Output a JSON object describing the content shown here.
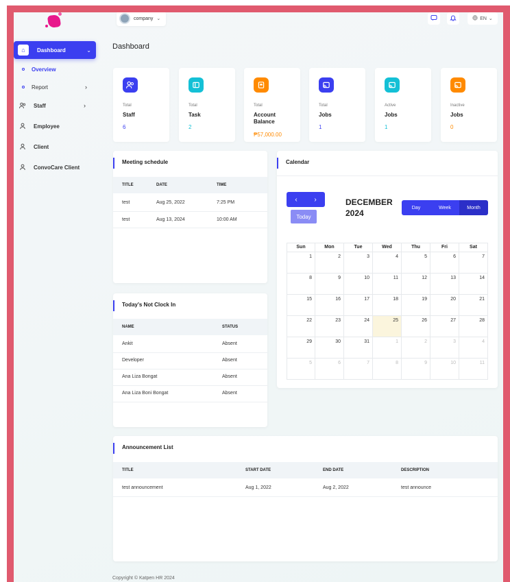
{
  "sidebar": {
    "items": [
      {
        "label": "Dashboard"
      },
      {
        "label": "Overview"
      },
      {
        "label": "Report"
      },
      {
        "label": "Staff"
      },
      {
        "label": "Employee"
      },
      {
        "label": "Client"
      },
      {
        "label": "ConvoCare Client"
      }
    ]
  },
  "header": {
    "company": "company",
    "language": "EN"
  },
  "page_title": "Dashboard",
  "stats": [
    {
      "caption": "Total",
      "title": "Staff",
      "value": "6",
      "icon": "users-icon",
      "icon_color": "#3b3ff0",
      "value_color": "#3b3ff0"
    },
    {
      "caption": "Total",
      "title": "Task",
      "value": "2",
      "icon": "task-icon",
      "icon_color": "#14c0d6",
      "value_color": "#14c0d6"
    },
    {
      "caption": "Total",
      "title": "Account Balance",
      "value": "₱57,000.00",
      "icon": "wallet-icon",
      "icon_color": "#ff8a00",
      "value_color": "#ff8a00"
    },
    {
      "caption": "Total",
      "title": "Jobs",
      "value": "1",
      "icon": "jobs-icon",
      "icon_color": "#3b3ff0",
      "value_color": "#3b3ff0"
    },
    {
      "caption": "Active",
      "title": "Jobs",
      "value": "1",
      "icon": "jobs-icon",
      "icon_color": "#14c0d6",
      "value_color": "#14c0d6"
    },
    {
      "caption": "Inactive",
      "title": "Jobs",
      "value": "0",
      "icon": "jobs-icon",
      "icon_color": "#ff8a00",
      "value_color": "#ff8a00"
    }
  ],
  "meeting": {
    "title": "Meeting schedule",
    "headers": [
      "TITLE",
      "DATE",
      "TIME"
    ],
    "rows": [
      [
        "test",
        "Aug 25, 2022",
        "7:25 PM"
      ],
      [
        "test",
        "Aug 13, 2024",
        "10:00 AM"
      ]
    ]
  },
  "not_clock_in": {
    "title": "Today's Not Clock In",
    "headers": [
      "NAME",
      "STATUS"
    ],
    "rows": [
      [
        "Ankit",
        "Absent"
      ],
      [
        "Developer",
        "Absent"
      ],
      [
        "Ana Liza Bongat",
        "Absent"
      ],
      [
        "Ana Liza Boni Bongat",
        "Absent"
      ]
    ]
  },
  "calendar": {
    "title": "Calendar",
    "prev": "‹",
    "next": "›",
    "today": "Today",
    "month": "DECEMBER",
    "year": "2024",
    "views": [
      "Day",
      "Week",
      "Month"
    ],
    "active_view": "Month",
    "weekdays": [
      "Sun",
      "Mon",
      "Tue",
      "Wed",
      "Thu",
      "Fri",
      "Sat"
    ],
    "weeks": [
      [
        "1",
        "2",
        "3",
        "4",
        "5",
        "6",
        "7"
      ],
      [
        "8",
        "9",
        "10",
        "11",
        "12",
        "13",
        "14"
      ],
      [
        "15",
        "16",
        "17",
        "18",
        "19",
        "20",
        "21"
      ],
      [
        "22",
        "23",
        "24",
        "25",
        "26",
        "27",
        "28"
      ],
      [
        "29",
        "30",
        "31",
        "1",
        "2",
        "3",
        "4"
      ],
      [
        "5",
        "6",
        "7",
        "8",
        "9",
        "10",
        "11"
      ]
    ],
    "today_date": "25"
  },
  "announcements": {
    "title": "Announcement List",
    "headers": [
      "TITLE",
      "START DATE",
      "END DATE",
      "DESCRIPTION"
    ],
    "rows": [
      [
        "test announcement",
        "Aug 1, 2022",
        "Aug 2, 2022",
        "test announce"
      ]
    ]
  },
  "footer": "Copyright © Katpen HR 2024"
}
